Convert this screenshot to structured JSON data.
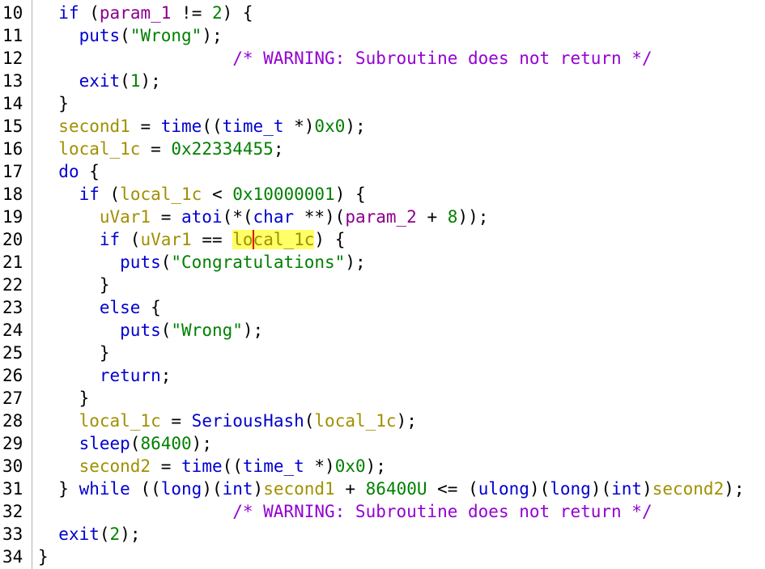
{
  "lines": [
    {
      "n": "10"
    },
    {
      "n": "11"
    },
    {
      "n": "12"
    },
    {
      "n": "13"
    },
    {
      "n": "14"
    },
    {
      "n": "15"
    },
    {
      "n": "16"
    },
    {
      "n": "17"
    },
    {
      "n": "18"
    },
    {
      "n": "19"
    },
    {
      "n": "20"
    },
    {
      "n": "21"
    },
    {
      "n": "22"
    },
    {
      "n": "23"
    },
    {
      "n": "24"
    },
    {
      "n": "25"
    },
    {
      "n": "26"
    },
    {
      "n": "27"
    },
    {
      "n": "28"
    },
    {
      "n": "29"
    },
    {
      "n": "30"
    },
    {
      "n": "31"
    },
    {
      "n": "32"
    },
    {
      "n": "33"
    },
    {
      "n": "34"
    }
  ],
  "tokens": {
    "kw_if": "if",
    "kw_do": "do",
    "kw_else": "else",
    "kw_return": "return",
    "kw_while": "while",
    "fn_puts": "puts",
    "fn_exit": "exit",
    "fn_time": "time",
    "fn_atoi": "atoi",
    "fn_serioushash": "SeriousHash",
    "fn_sleep": "sleep",
    "t_time_t": "time_t",
    "t_char": "char",
    "t_long": "long",
    "t_int": "int",
    "t_ulong": "ulong",
    "v_param_1": "param_1",
    "v_param_2": "param_2",
    "v_second1": "second1",
    "v_second2": "second2",
    "v_local_1c": "local_1c",
    "v_uvar1": "uVar1",
    "v_local_1c_a": "lo",
    "v_local_1c_b": "cal_1c",
    "s_wrong": "\"Wrong\"",
    "s_congrats": "\"Congratulations\"",
    "n_2": "2",
    "n_1": "1",
    "n_0x0": "0x0",
    "n_22334455": "0x22334455",
    "n_10000001": "0x10000001",
    "n_8": "8",
    "n_86400": "86400",
    "n_86400u": "86400U",
    "c_warning": "/* WARNING: Subroutine does not return */"
  }
}
